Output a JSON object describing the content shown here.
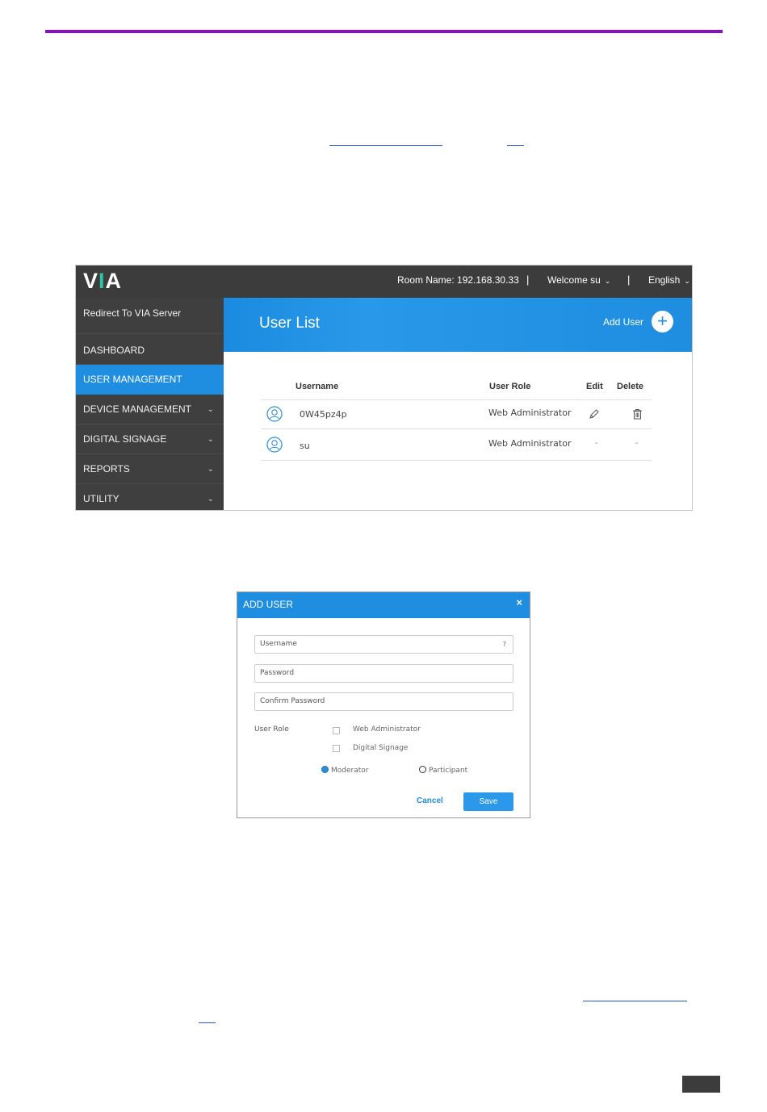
{
  "colors": {
    "rule": "#8a0fc4",
    "accent": "#1f8de0",
    "topbar": "#3c3c3c",
    "sidebar": "#3f3f3f",
    "logo_bar": "#2ec4a8"
  },
  "via": {
    "logo": {
      "left": "V",
      "bar": "I",
      "right": "A"
    },
    "topbar": {
      "room": "Room Name: 192.168.30.33",
      "separator": "|",
      "welcome": "Welcome su",
      "language": "English"
    },
    "sidebar": {
      "items": [
        {
          "label": "Redirect To VIA Server",
          "has_chevron": false
        },
        {
          "label": "DASHBOARD",
          "has_chevron": false
        },
        {
          "label": "USER MANAGEMENT",
          "has_chevron": false,
          "active": true
        },
        {
          "label": "DEVICE MANAGEMENT",
          "has_chevron": true
        },
        {
          "label": "DIGITAL SIGNAGE",
          "has_chevron": true
        },
        {
          "label": "REPORTS",
          "has_chevron": true
        },
        {
          "label": "UTILITY",
          "has_chevron": true
        }
      ]
    },
    "banner": {
      "title": "User List",
      "add_user": "Add User",
      "add_icon": "plus-circle-icon"
    },
    "table": {
      "headers": {
        "username": "Username",
        "role": "User Role",
        "edit": "Edit",
        "delete": "Delete"
      },
      "rows": [
        {
          "username": "0W45pz4p",
          "role": "Web Administrator",
          "edit": "pencil-icon",
          "delete": "trash-icon"
        },
        {
          "username": "su",
          "role": "Web Administrator",
          "edit": "-",
          "delete": "-"
        }
      ]
    }
  },
  "dialog": {
    "title": "ADD USER",
    "close": "×",
    "username_placeholder": "Username",
    "username_help": "?",
    "password_placeholder": "Password",
    "confirm_placeholder": "Confirm Password",
    "role_label": "User Role",
    "checkboxes": [
      "Web Administrator",
      "Digital Signage"
    ],
    "radios": {
      "moderator": "Moderator",
      "participant": "Participant",
      "selected": "Moderator"
    },
    "cancel": "Cancel",
    "save": "Save"
  }
}
